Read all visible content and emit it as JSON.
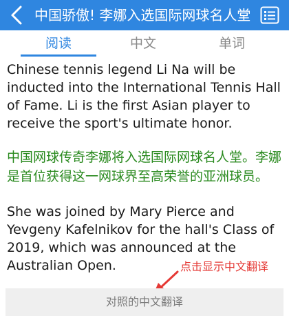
{
  "header": {
    "title": "中国骄傲! 李娜入选国际网球名人堂",
    "back_icon": "back-chevron-icon",
    "menu_icon": "list-menu-icon",
    "bar_color": "#2f86e0"
  },
  "tabs": [
    {
      "label": "阅读",
      "active": true
    },
    {
      "label": "中文",
      "active": false
    },
    {
      "label": "单词",
      "active": false
    }
  ],
  "article": {
    "paragraphs": [
      "Chinese tennis legend Li Na will be inducted into the International Tennis Hall of Fame. Li is the first Asian player to receive the sport's ultimate honor.",
      "中国网球传奇李娜将入选国际网球名人堂。李娜是首位获得这一网球界至高荣誉的亚洲球员。",
      "She was joined by Mary Pierce and Yevgeny Kafelnikov for the hall's Class of 2019, which was announced at the Australian Open."
    ],
    "translation_color": "#2a8a1f"
  },
  "footer": {
    "toggle_label": "对照的中文翻译"
  },
  "annotation": {
    "text": "点击显示中文翻译",
    "color": "#e53935"
  }
}
